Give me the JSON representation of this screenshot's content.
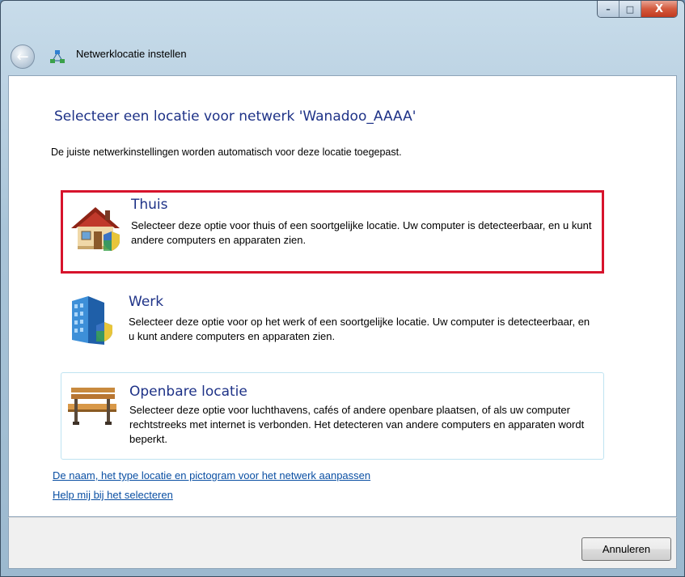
{
  "window": {
    "title": "Netwerklocatie instellen",
    "controls": {
      "minimize": "–",
      "maximize": "□",
      "close": "X"
    }
  },
  "main": {
    "heading": "Selecteer een locatie voor netwerk 'Wanadoo_AAAA'",
    "description": "De juiste netwerkinstellingen worden automatisch voor deze locatie toegepast.",
    "options": [
      {
        "title": "Thuis",
        "description": "Selecteer deze optie voor thuis of een soortgelijke locatie. Uw computer is detecteerbaar, en u kunt andere computers en apparaten zien.",
        "icon": "house-icon",
        "highlighted": true
      },
      {
        "title": "Werk",
        "description": "Selecteer deze optie voor op het werk of een soortgelijke locatie. Uw computer is detecteerbaar, en u kunt andere computers en apparaten zien.",
        "icon": "office-building-icon",
        "highlighted": false
      },
      {
        "title": "Openbare locatie",
        "description": "Selecteer deze optie voor luchthavens, cafés of andere openbare plaatsen, of als uw computer rechtstreeks met internet is verbonden. Het detecteren van andere computers en apparaten wordt beperkt.",
        "icon": "park-bench-icon",
        "highlighted": false
      }
    ],
    "links": {
      "customize": "De naam, het type locatie en pictogram voor het netwerk aanpassen",
      "help": "Help mij bij het selecteren"
    }
  },
  "footer": {
    "cancel_label": "Annuleren"
  },
  "colors": {
    "heading": "#1e3287",
    "highlight_border": "#d7132c",
    "link": "#0a4fa3"
  }
}
